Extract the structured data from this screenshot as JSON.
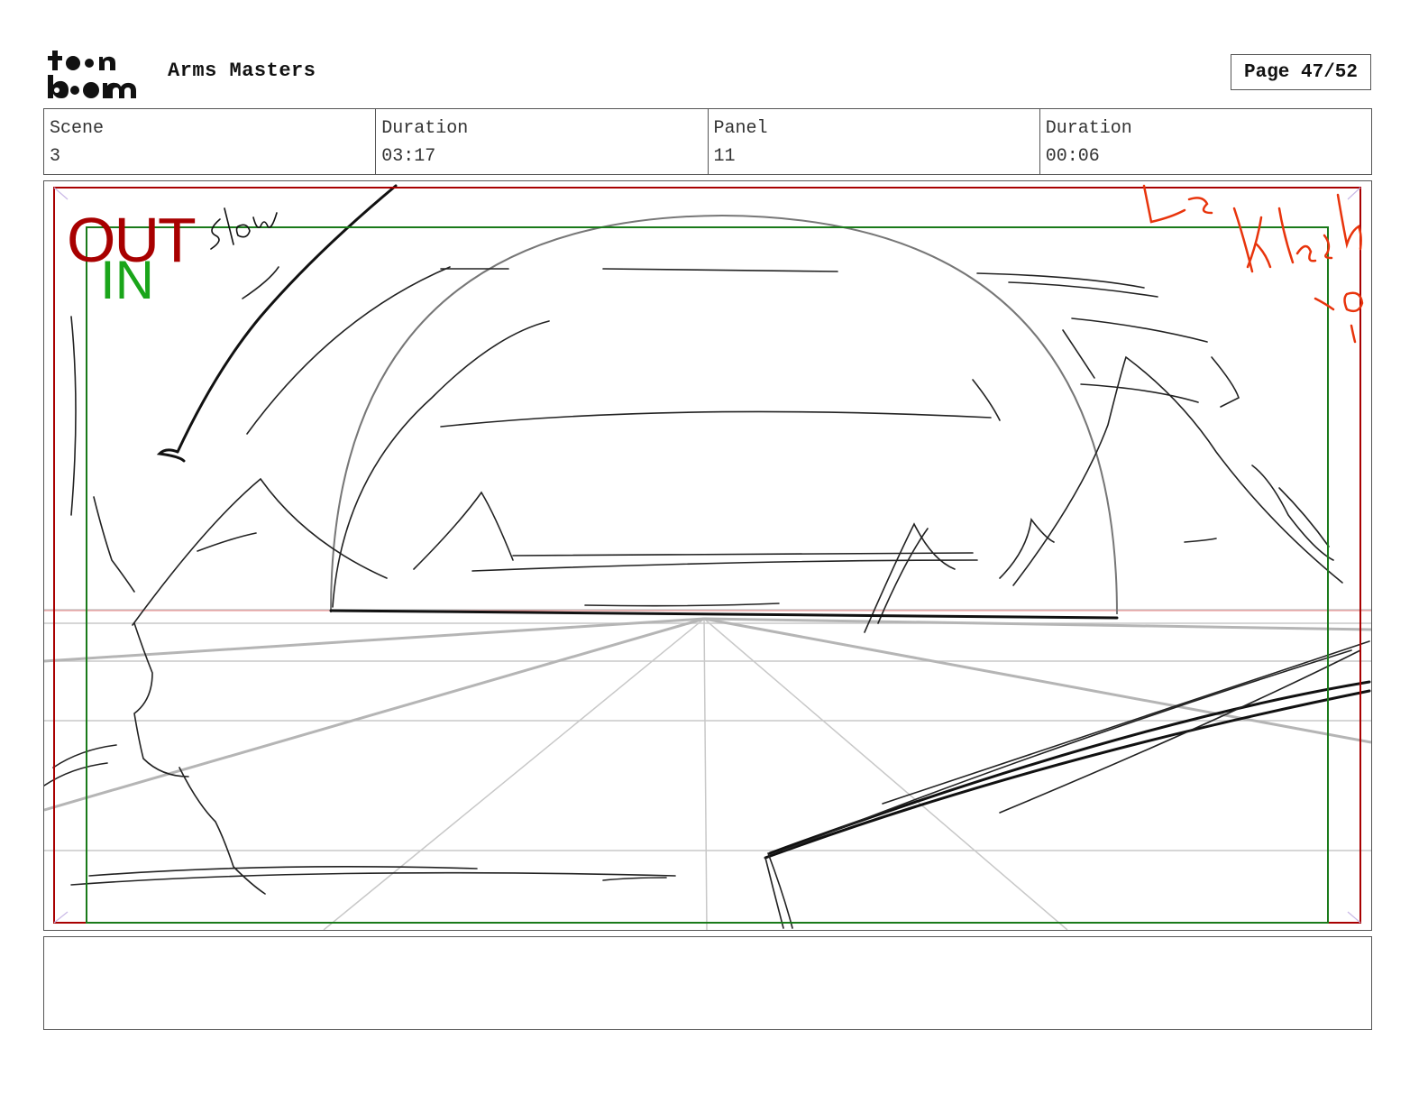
{
  "header": {
    "logo_name": "toonboom-logo",
    "project_title": "Arms Masters",
    "page_indicator": "Page 47/52"
  },
  "info": {
    "scene_label": "Scene",
    "scene_value": "3",
    "scene_duration_label": "Duration",
    "scene_duration_value": "03:17",
    "panel_label": "Panel",
    "panel_value": "11",
    "panel_duration_label": "Duration",
    "panel_duration_value": "00:06"
  },
  "panel": {
    "out_label": "OUT",
    "in_label": "IN",
    "handwritten_notes": [
      "slow",
      "Flash",
      "Len"
    ],
    "colors": {
      "out_frame": "#a80000",
      "in_frame": "#1a7a1a",
      "annotation": "#e8340c",
      "sketch": "#111111",
      "guides": "#bbbbbb"
    }
  },
  "notes": {
    "text": ""
  }
}
